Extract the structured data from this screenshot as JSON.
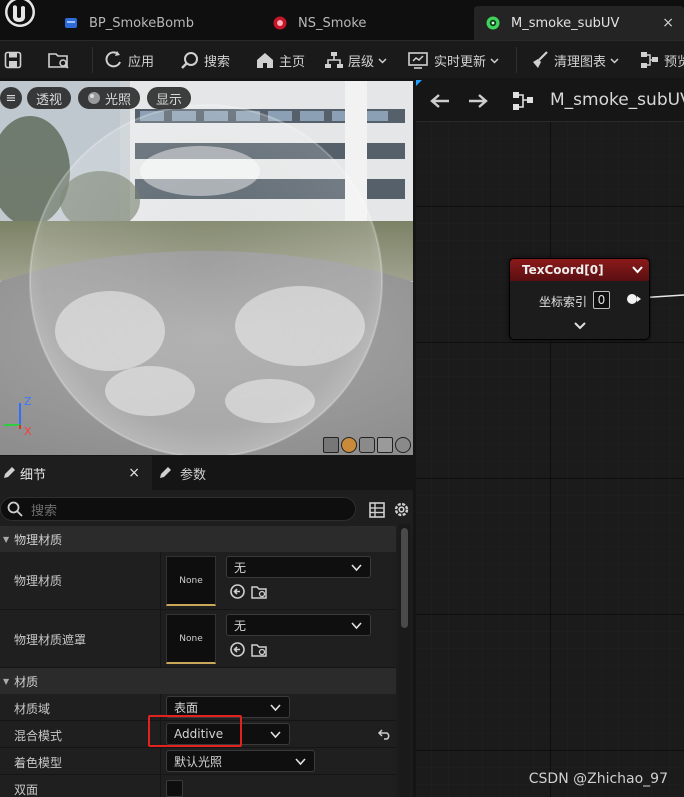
{
  "tabs": [
    {
      "label": "BP_SmokeBomb",
      "active": false
    },
    {
      "label": "NS_Smoke",
      "active": false
    },
    {
      "label": "M_smoke_subUV",
      "active": true
    }
  ],
  "tab_close": "×",
  "toolbar": {
    "apply": "应用",
    "search": "搜索",
    "home": "主页",
    "hierarchy": "层级",
    "live_update": "实时更新",
    "clean_graph": "清理图表",
    "preview": "预览"
  },
  "viewport": {
    "menu_icon": "≡",
    "perspective": "透视",
    "lit": "光照",
    "show": "显示",
    "axis_z": "Z",
    "axis_x": "X"
  },
  "details": {
    "tab_details": "细节",
    "tab_params": "参数",
    "tab_close": "×",
    "search_placeholder": "搜索",
    "sections": {
      "physical_material": "物理材质",
      "material": "材质"
    },
    "props": {
      "phys_mat_label": "物理材质",
      "phys_mat_thumb": "None",
      "phys_mat_value": "无",
      "phys_mask_label": "物理材质遮罩",
      "phys_mask_thumb": "None",
      "phys_mask_value": "无",
      "domain_label": "材质域",
      "domain_value": "表面",
      "blend_label": "混合模式",
      "blend_value": "Additive",
      "shading_label": "着色模型",
      "shading_value": "默认光照",
      "twosided_label": "双面"
    }
  },
  "graph": {
    "title": "M_smoke_subUV",
    "node": {
      "title": "TexCoord[0]",
      "pin_label": "坐标索引",
      "pin_value": "0"
    }
  },
  "watermark": "CSDN @Zhichao_97",
  "colors": {
    "highlight_box": "#e0231f",
    "node_header": "#8a1a1a",
    "accent": "#1fa0ff"
  }
}
